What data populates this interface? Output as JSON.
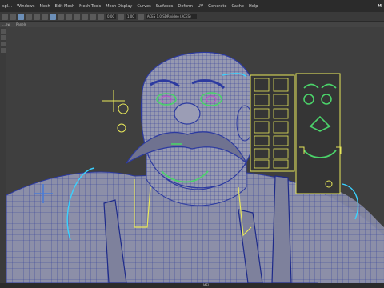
{
  "app": {
    "brand": "M"
  },
  "menubar": {
    "items": [
      "spl…",
      "Windows",
      "Mesh",
      "Edit Mesh",
      "Mesh Tools",
      "Mesh Display",
      "Curves",
      "Surfaces",
      "Deform",
      "UV",
      "Generate",
      "Cache",
      "Help"
    ]
  },
  "toolbar": {
    "value_a": "0.00",
    "value_b": "1.00",
    "colorspace": "ACES 1.0 SDR-video (ACES)"
  },
  "panel_menu": {
    "items": [
      "…ew",
      "Panels"
    ]
  },
  "statusbar": {
    "mode": "MEL"
  },
  "colors": {
    "background": "#3f3f3f",
    "mesh_fill": "#8a8da5",
    "wireframe": "#2c3aa0",
    "control_yellow": "#e8e85a",
    "control_green": "#4bd36a",
    "control_cyan": "#3ad1ff",
    "control_blue": "#4a7bd6"
  }
}
